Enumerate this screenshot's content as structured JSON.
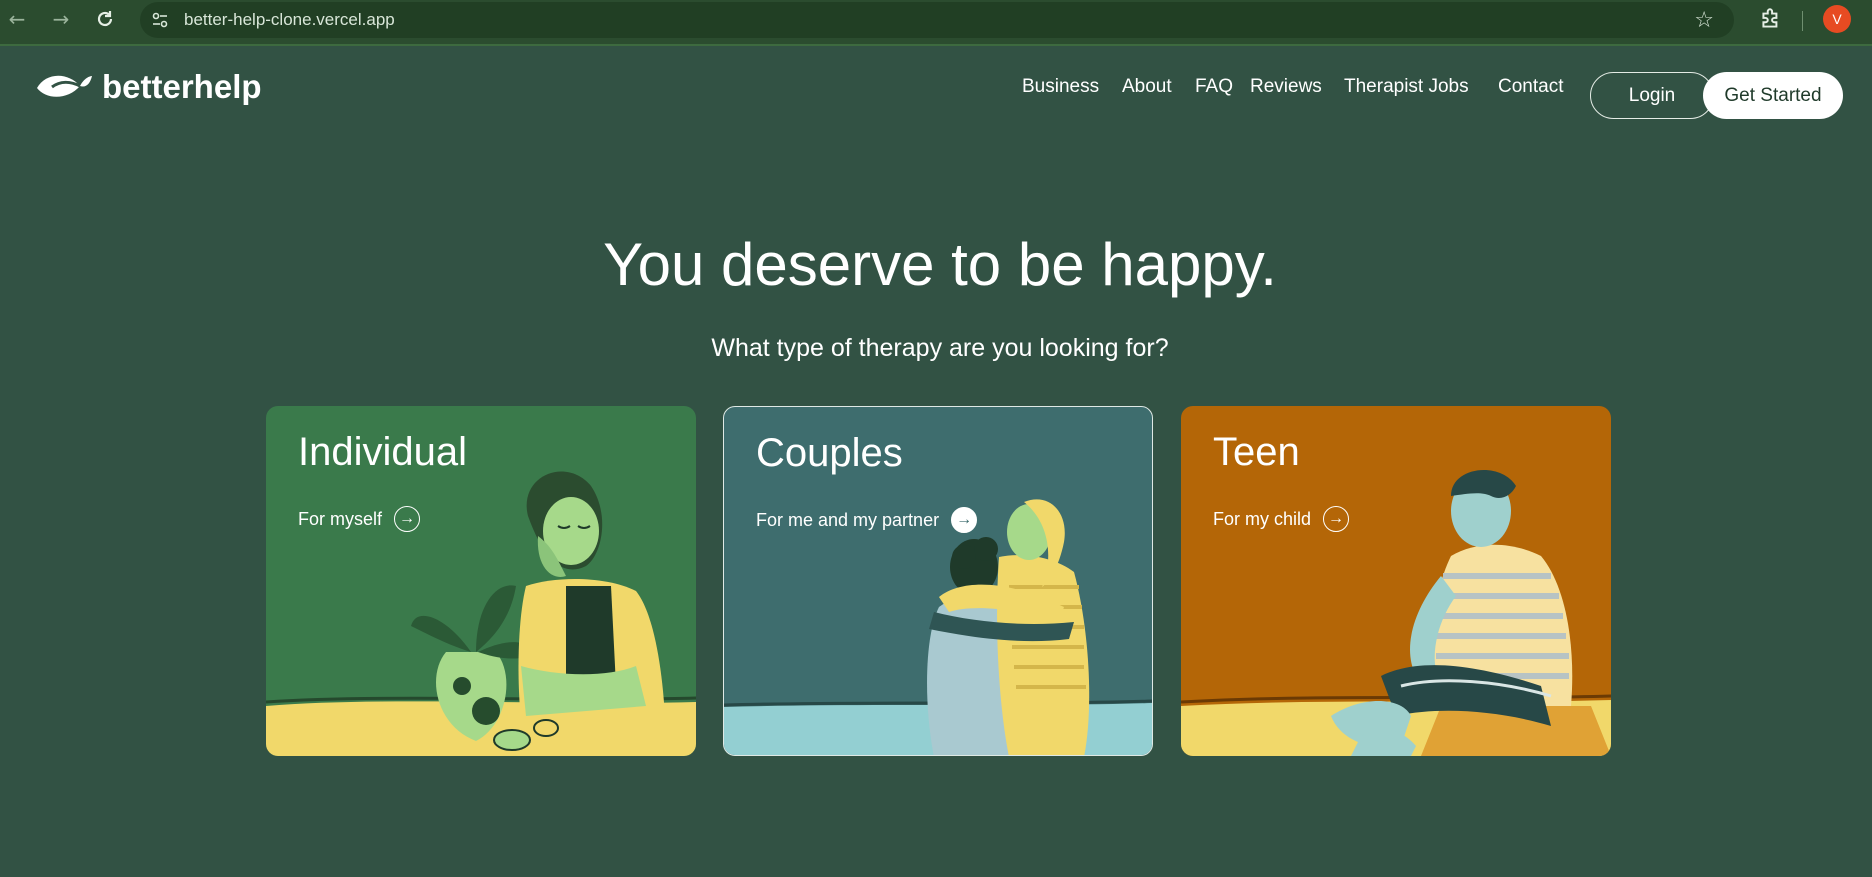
{
  "browser": {
    "url": "better-help-clone.vercel.app",
    "profile_initial": "V",
    "icons": [
      "back-icon",
      "forward-icon",
      "reload-icon",
      "site-info-icon",
      "star-icon",
      "extensions-icon"
    ]
  },
  "header": {
    "logo_text": "betterhelp",
    "nav": [
      "Business",
      "About",
      "FAQ",
      "Reviews",
      "Therapist Jobs",
      "Contact"
    ],
    "login_label": "Login",
    "get_started_label": "Get Started"
  },
  "hero": {
    "headline": "You deserve to be happy.",
    "subhead": "What type of therapy are you looking for?"
  },
  "cards": [
    {
      "title": "Individual",
      "subtitle": "For myself",
      "color": "#3a7a4b"
    },
    {
      "title": "Couples",
      "subtitle": "For me and my partner",
      "color": "#3e6d6e"
    },
    {
      "title": "Teen",
      "subtitle": "For my child",
      "color": "#b46607"
    }
  ],
  "colors": {
    "background": "#325244",
    "accent_yellow": "#f1d86a",
    "teen_orange": "#b46607"
  }
}
